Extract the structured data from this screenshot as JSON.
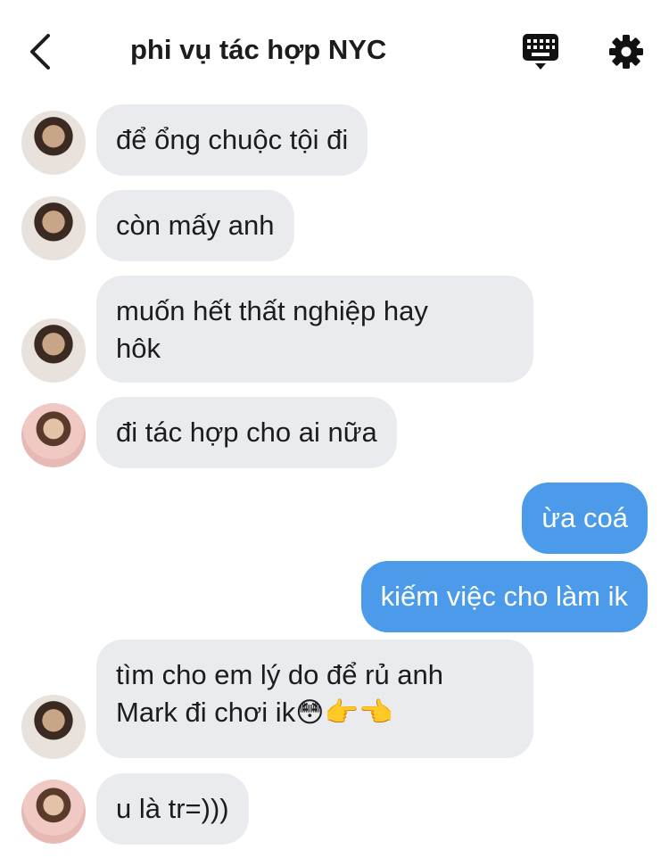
{
  "header": {
    "title": "phi vụ tác hợp NYC",
    "back_icon": "chevron-left-icon",
    "keyboard_icon": "keyboard-icon",
    "settings_icon": "gear-icon"
  },
  "messages": [
    {
      "side": "in",
      "avatar": "avatar-1",
      "text": "để ổng chuộc tội đi"
    },
    {
      "side": "in",
      "avatar": "avatar-1",
      "text": "còn mấy anh"
    },
    {
      "side": "in",
      "avatar": "avatar-1",
      "text": "muốn hết thất nghiệp hay\nhôk"
    },
    {
      "side": "in",
      "avatar": "avatar-2",
      "text": "đi tác hợp cho ai nữa"
    },
    {
      "side": "out",
      "text": "ừa coá"
    },
    {
      "side": "out",
      "text": "kiếm việc cho làm ik"
    },
    {
      "side": "in",
      "avatar": "avatar-1",
      "text": "tìm cho em lý do để rủ anh\nMark đi chơi ik😳👉👈"
    },
    {
      "side": "in",
      "avatar": "avatar-2",
      "text": "u là tr=)))"
    }
  ],
  "colors": {
    "incoming_bubble": "#e9ebef",
    "outgoing_bubble": "#4b9bea",
    "outgoing_text": "#ffffff"
  }
}
